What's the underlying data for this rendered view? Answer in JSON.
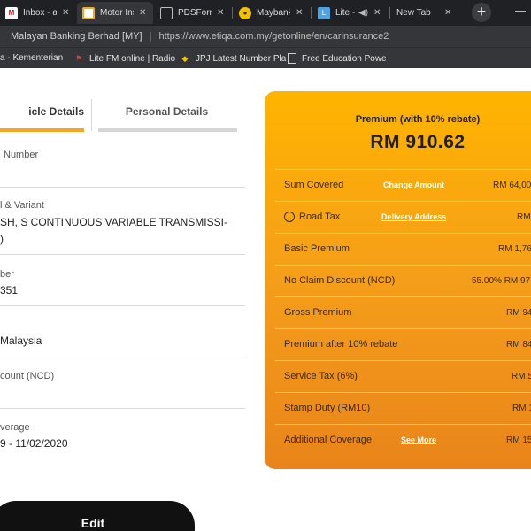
{
  "browser": {
    "tabs": [
      {
        "label": "Inbox - a",
        "icon": "gmail-icon",
        "color": "#c5221f"
      },
      {
        "label": "Motor Ins",
        "icon": "etiqa-icon",
        "color": "#f5a623"
      },
      {
        "label": "PDSForm",
        "icon": "document-icon",
        "color": "#8ab4f8"
      },
      {
        "label": "Maybank",
        "icon": "maybank-icon",
        "color": "#f2c200"
      },
      {
        "label": "Lite -",
        "icon": "litefm-icon",
        "color": "#4fa3e0"
      },
      {
        "label": "New Tab",
        "icon": "",
        "color": ""
      }
    ],
    "new_tab_symbol": "+",
    "address": {
      "site_name": "Malayan Banking Berhad [MY]",
      "separator": "|",
      "url": "https://www.etiqa.com.my/getonline/en/carinsurance2"
    },
    "bookmarks": [
      {
        "label": "a - Kementerian",
        "icon": "bookmark-icon"
      },
      {
        "label": "Lite FM online | Radio",
        "icon": "flag-icon"
      },
      {
        "label": "JPJ Latest Number Pla",
        "icon": "jpj-icon"
      },
      {
        "label": "Free Education Powe",
        "icon": "page-icon"
      }
    ]
  },
  "details": {
    "tab_vehicle": "icle Details",
    "tab_personal": "Personal Details",
    "fields": [
      {
        "label": "Number",
        "value": ""
      },
      {
        "label": "l & Variant",
        "value": "SH, S CONTINUOUS VARIABLE TRANSMISSI-",
        "value2": ")"
      },
      {
        "label": "ber",
        "value": "351"
      },
      {
        "label": "",
        "value": "Malaysia"
      },
      {
        "label": "count (NCD)",
        "value": ""
      },
      {
        "label": "verage",
        "value": "9 - 11/02/2020"
      }
    ],
    "edit_label": "Edit"
  },
  "premium": {
    "title": "Premium (with 10% rebate)",
    "amount": "RM 910.62",
    "rows": [
      {
        "label": "Sum Covered",
        "link": "Change Amount",
        "value": "RM 64,00"
      },
      {
        "label": "Road Tax",
        "link": "Delivery Address",
        "value": "RM"
      },
      {
        "label": "Basic Premium",
        "link": "",
        "value": "RM 1,76"
      },
      {
        "label": "No Claim Discount (NCD)",
        "link": "",
        "value": "55.00% RM 97"
      },
      {
        "label": "Gross Premium",
        "link": "",
        "value": "RM 94"
      },
      {
        "label": "Premium after 10% rebate",
        "link": "",
        "value": "RM 84"
      },
      {
        "label": "Service Tax (6%)",
        "link": "",
        "value": "RM 5"
      },
      {
        "label": "Stamp Duty (RM10)",
        "link": "",
        "value": "RM 1"
      },
      {
        "label": "Additional Coverage",
        "link": "See More",
        "value": "RM 15"
      }
    ]
  },
  "colors": {
    "accent": "#f5a623",
    "card_top": "#ffb400",
    "card_bottom": "#e9841a",
    "browser_dark": "#202124"
  }
}
